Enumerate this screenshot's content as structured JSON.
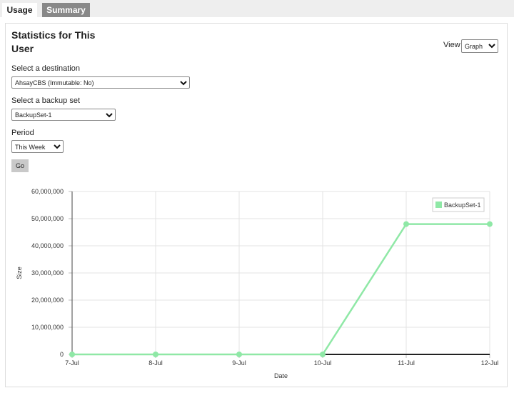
{
  "tabs": {
    "usage": "Usage",
    "summary": "Summary"
  },
  "header": {
    "title": "Statistics for This User",
    "view_label": "View",
    "view_value": "Graph"
  },
  "form": {
    "destination_label": "Select a destination",
    "destination_value": "AhsayCBS (Immutable: No)",
    "backup_set_label": "Select a backup set",
    "backup_set_value": "BackupSet-1",
    "period_label": "Period",
    "period_value": "This Week",
    "go_label": "Go"
  },
  "chart_data": {
    "type": "line",
    "x": [
      "7-Jul",
      "8-Jul",
      "9-Jul",
      "10-Jul",
      "11-Jul",
      "12-Jul"
    ],
    "series": [
      {
        "name": "BackupSet-1",
        "values": [
          0,
          0,
          0,
          0,
          48000000,
          48000000
        ],
        "color": "#8fe8a6"
      }
    ],
    "ytick_labels": [
      "0",
      "10,000,000",
      "20,000,000",
      "30,000,000",
      "40,000,000",
      "50,000,000",
      "60,000,000"
    ],
    "ytick_values": [
      0,
      10000000,
      20000000,
      30000000,
      40000000,
      50000000,
      60000000
    ],
    "xlabel": "Date",
    "ylabel": "Size",
    "ylim": [
      0,
      60000000
    ],
    "grid": true,
    "legend": "top-right"
  }
}
